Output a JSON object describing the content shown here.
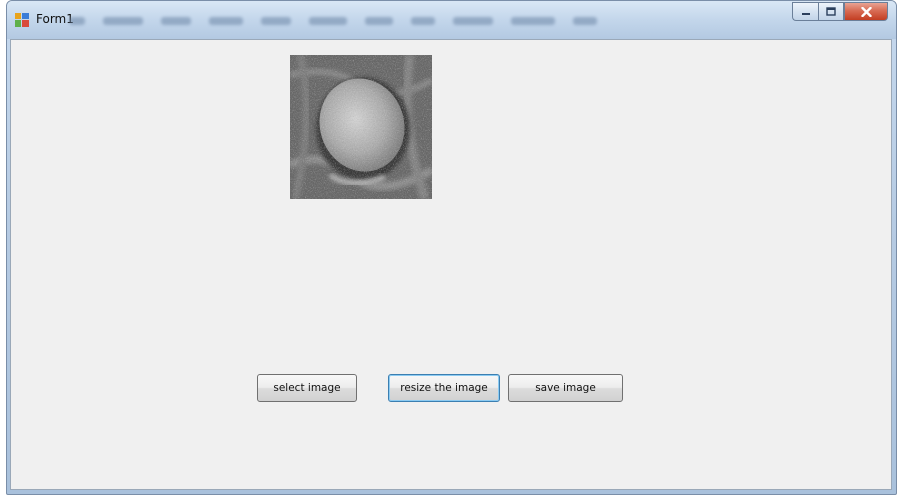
{
  "window": {
    "title": "Form1",
    "icon": "winforms-form-icon",
    "controls": {
      "minimize": "minimize-icon",
      "maximize": "maximize-icon",
      "close": "close-icon"
    }
  },
  "picture_box": {
    "content": "grayscale-medical-scan-image"
  },
  "buttons": {
    "select_label": "select image",
    "resize_label": "resize the image",
    "save_label": "save image"
  },
  "colors": {
    "client_background": "#f0f0f0",
    "titlebar": "#c3d6eb",
    "close_button": "#c33e22",
    "focused_button_border": "#3c7fb1"
  }
}
